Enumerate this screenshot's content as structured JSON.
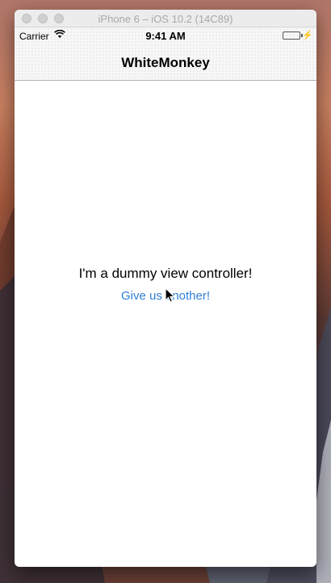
{
  "window": {
    "title": "iPhone 6 – iOS 10.2 (14C89)"
  },
  "status_bar": {
    "carrier": "Carrier",
    "time": "9:41 AM",
    "battery_color": "#4cd964"
  },
  "nav_bar": {
    "title": "WhiteMonkey"
  },
  "content": {
    "message": "I'm a dummy view controller!",
    "button_label": "Give us another!",
    "button_color": "#2f7fd8"
  }
}
